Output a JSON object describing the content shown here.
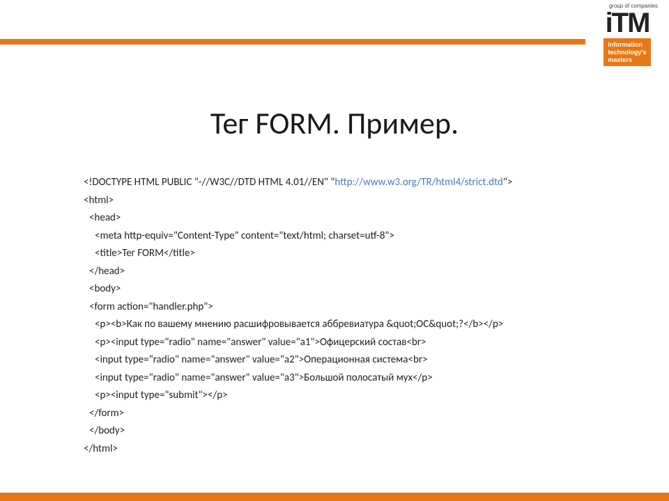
{
  "logo": {
    "tagline_top": "group of companies",
    "name": "iTM",
    "box_line1": "information",
    "box_line2": "technology's",
    "box_line3": "masters"
  },
  "slide": {
    "title": "Тег FORM. Пример."
  },
  "code": {
    "l1a": "<!DOCTYPE HTML PUBLIC \"-//W3C//DTD HTML 4.01//EN\" \"",
    "l1b": "http://www.w3.org/TR/html4/strict.dtd",
    "l1c": "\">",
    "l2": "<html>",
    "l3": "<head>",
    "l4": "<meta http-equiv=\"Content-Type\" content=\"text/html; charset=utf-8\">",
    "l5": "<title>Тег FORM</title>",
    "l6": "</head>",
    "l7": "<body>",
    "l8": "<form action=\"handler.php\">",
    "l9": "<p><b>Как по вашему мнению расшифровывается аббревиатура &quot;ОС&quot;?</b></p>",
    "l10": "<p><input type=\"radio\" name=\"answer\" value=\"a1\">Офицерский состав<br>",
    "l11": "<input type=\"radio\" name=\"answer\" value=\"a2\">Операционная система<br>",
    "l12": "<input type=\"radio\" name=\"answer\" value=\"a3\">Большой полосатый мух</p>",
    "l13": "<p><input type=\"submit\"></p>",
    "l14": "</form>",
    "l15": "</body>",
    "l16": "</html>"
  }
}
